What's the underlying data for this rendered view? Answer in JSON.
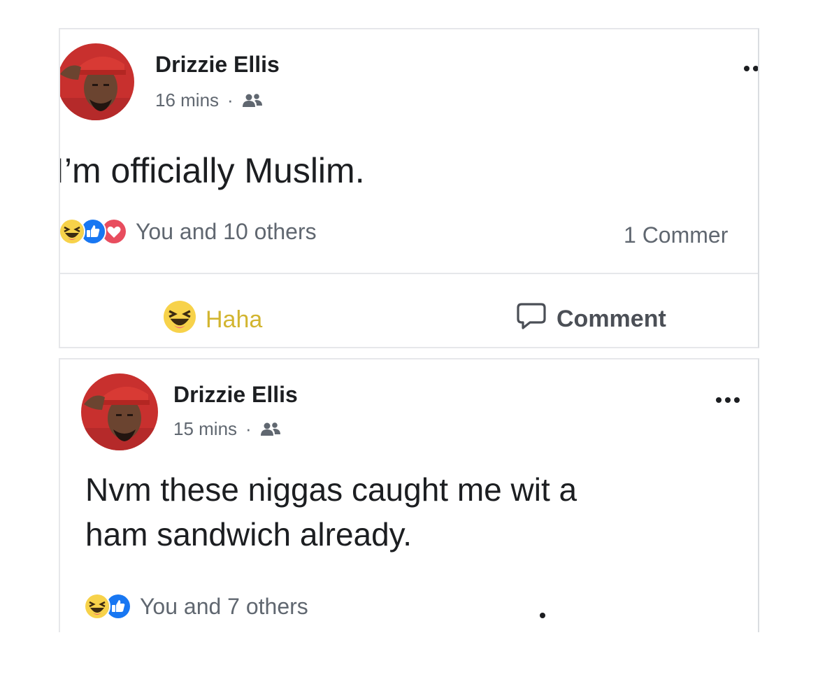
{
  "posts": [
    {
      "author": "Drizzie Ellis",
      "time": "16 mins",
      "separator": "·",
      "audience_icon": "friends-icon",
      "text_lines": [
        "I’m officially Muslim."
      ],
      "reaction_icons": [
        "haha-icon",
        "like-icon",
        "love-icon"
      ],
      "reactions_text": "You and 10 others",
      "comments_count": "1 Commer",
      "actions": {
        "haha_label": "Haha",
        "comment_label": "Comment"
      }
    },
    {
      "author": "Drizzie Ellis",
      "time": "15 mins",
      "separator": "·",
      "audience_icon": "friends-icon",
      "text_lines": [
        "Nvm these niggas caught me wit a",
        "ham sandwich already."
      ],
      "reaction_icons": [
        "haha-icon",
        "like-icon"
      ],
      "reactions_text": "You and 7 others"
    }
  ],
  "colors": {
    "haha_active": "#d2b530",
    "like_blue": "#1877f2",
    "love_red": "#e84d5e",
    "meta_gray": "#606770"
  }
}
